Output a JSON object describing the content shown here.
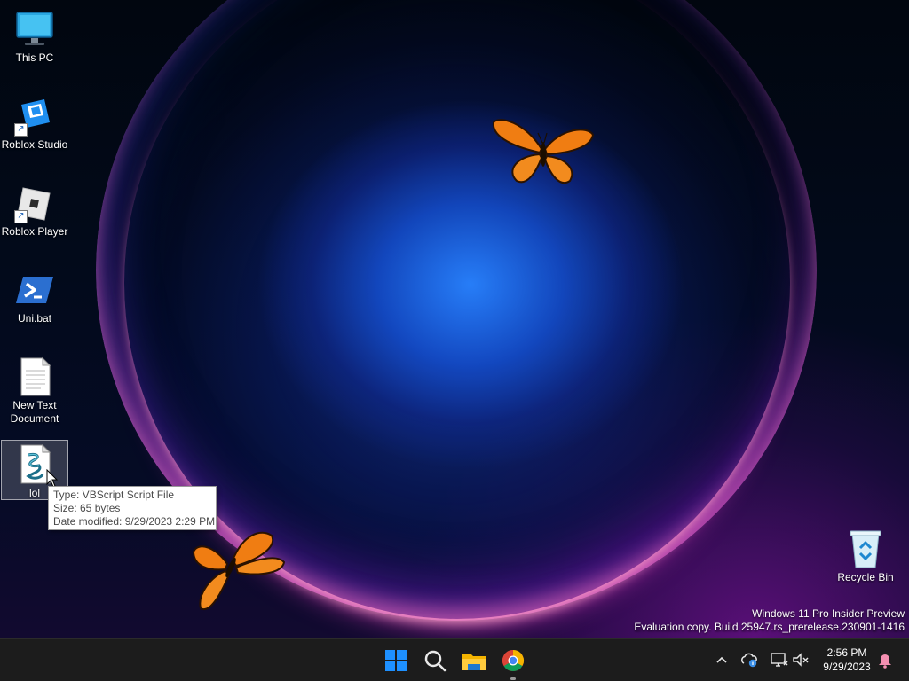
{
  "desktop": {
    "icons": [
      {
        "label": "This PC",
        "icon": "monitor-icon"
      },
      {
        "label": "Roblox Studio",
        "icon": "roblox-studio-icon"
      },
      {
        "label": "Roblox Player",
        "icon": "roblox-player-icon"
      },
      {
        "label": "Uni.bat",
        "icon": "powershell-icon"
      },
      {
        "label": "New Text Document",
        "icon": "text-document-icon"
      },
      {
        "label": "lol",
        "icon": "vbscript-file-icon"
      }
    ],
    "recycle_bin": {
      "label": "Recycle Bin",
      "icon": "recycle-bin-icon"
    }
  },
  "tooltip": {
    "type": "Type: VBScript Script File",
    "size": "Size: 65 bytes",
    "modified": "Date modified: 9/29/2023 2:29 PM"
  },
  "watermark": {
    "line1": "Windows 11 Pro Insider Preview",
    "line2": "Evaluation copy. Build 25947.rs_prerelease.230901-1416"
  },
  "taskbar": {
    "apps": [
      {
        "icon": "start-icon"
      },
      {
        "icon": "search-icon"
      },
      {
        "icon": "file-explorer-icon"
      },
      {
        "icon": "chrome-icon"
      }
    ],
    "tray": {
      "time": "2:56 PM",
      "date": "9/29/2023"
    }
  },
  "colors": {
    "taskbar_bg": "#1c1c1c",
    "start_blue": "#1e90ff",
    "butterfly_orange": "#f07d12",
    "notification_pink": "#f48fb1"
  }
}
